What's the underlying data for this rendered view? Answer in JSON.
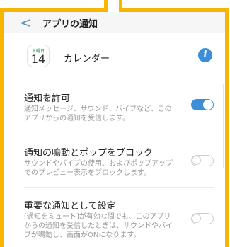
{
  "header": {
    "back_label": "<",
    "title": "アプリの通知"
  },
  "app": {
    "icon_day": "木曜日",
    "icon_date": "14",
    "name": "カレンダー",
    "info_symbol": "i"
  },
  "settings": [
    {
      "title": "通知を許可",
      "description": "通知メッセージ、サウンド、バイブなど、このアプリからの通知を受信します。",
      "enabled": true
    },
    {
      "title": "通知の鳴動とポップをブロック",
      "description": "サウンドやバイブの使用、およびポップアップでのプレビュー表示をブロックします。",
      "enabled": false
    },
    {
      "title": "重要な通知として設定",
      "description": "[通知をミュート]が有効な間でも、このアプリからの通知を受信したときは、サウンドやバイブが鳴動し、画面がONになります。",
      "enabled": false
    }
  ],
  "colors": {
    "accent": "#3a8fd8",
    "highlight_frame": "#f7b500"
  }
}
